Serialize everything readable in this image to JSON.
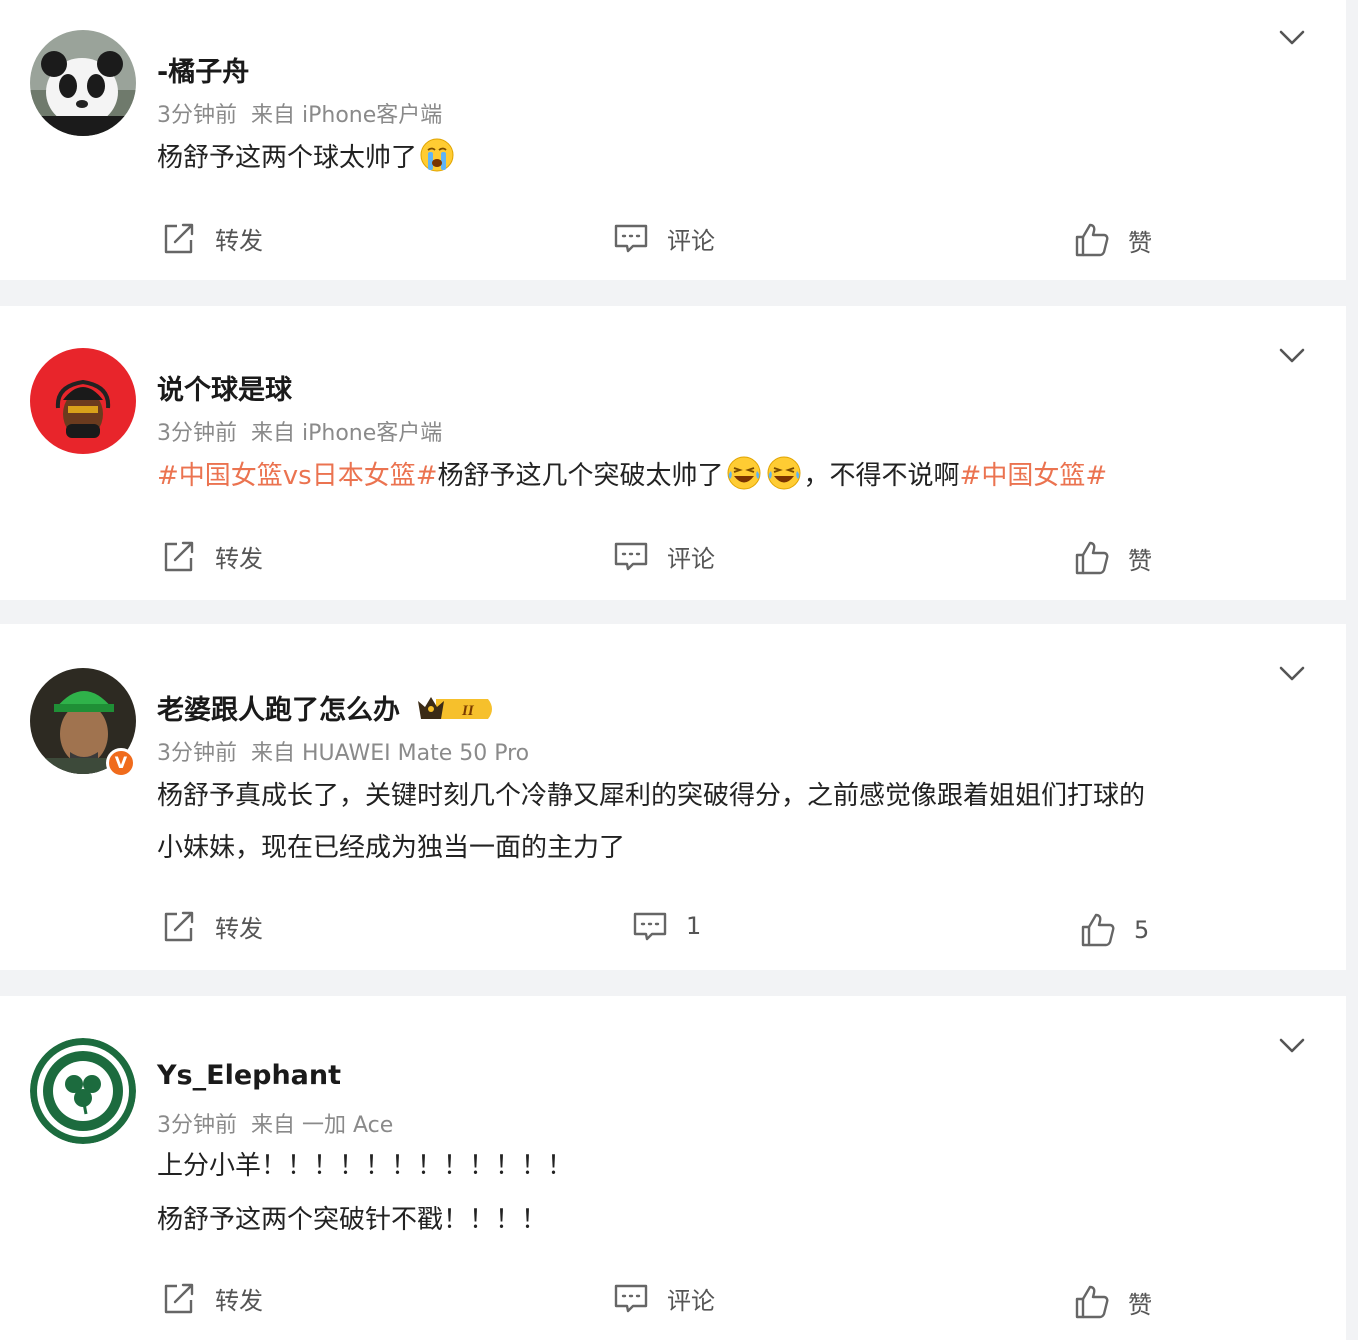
{
  "labels": {
    "repost": "转发",
    "comment": "评论",
    "like": "赞"
  },
  "posts": [
    {
      "username": "-橘子舟",
      "time": "3分钟前",
      "source": "来自 iPhone客户端",
      "text_line1": "杨舒予这两个球太帅了",
      "emoji": "crying-face",
      "avatar": "panda-avatar",
      "comment_count": null,
      "like_count": null
    },
    {
      "username": "说个球是球",
      "time": "3分钟前",
      "source": "来自 iPhone客户端",
      "topic1": "#中国女篮vs日本女篮#",
      "text_mid": "杨舒予这几个突破太帅了",
      "text_after": "，不得不说啊",
      "topic2": "#中国女篮#",
      "emoji": "laughing-crying-face",
      "avatar": "red-character-avatar"
    },
    {
      "username": "老婆跟人跑了怎么办",
      "badge_text": "II",
      "time": "3分钟前",
      "source": "来自 HUAWEI Mate 50 Pro",
      "text_line1": "杨舒予真成长了，关键时刻几个冷静又犀利的突破得分，之前感觉像跟着姐姐们打球的",
      "text_line2": "小妹妹，现在已经成为独当一面的主力了",
      "comment_count": "1",
      "like_count": "5",
      "verified": "V",
      "avatar": "green-hat-man-avatar"
    },
    {
      "username": "Ys_Elephant",
      "time": "3分钟前",
      "source": "来自 一加 Ace",
      "text_line1": "上分小羊！！！！！！！！！！！！",
      "text_line2": "杨舒予这两个突破针不戳！！！！",
      "avatar": "boston-clover-avatar"
    }
  ],
  "colors": {
    "topic": "#eb7350",
    "meta": "#8a8a8a",
    "badge": "#f06b1c",
    "background": "#f2f3f5"
  }
}
